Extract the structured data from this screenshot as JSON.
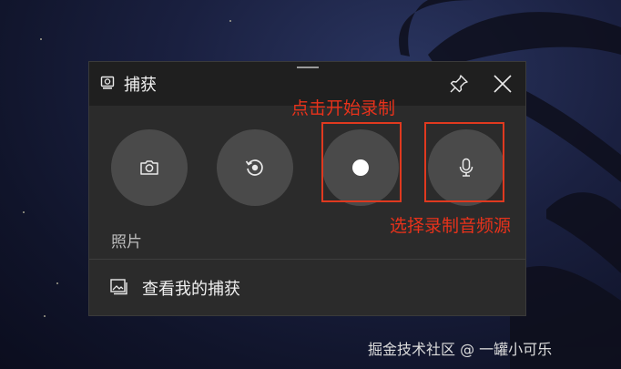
{
  "window": {
    "title": "捕获",
    "icon": "capture-icon"
  },
  "toolbar": {
    "pin_icon": "pin-icon",
    "close_icon": "close-icon"
  },
  "buttons": [
    {
      "name": "screenshot",
      "icon": "camera-icon"
    },
    {
      "name": "record-last-30s",
      "icon": "replay-icon"
    },
    {
      "name": "start-recording",
      "icon": "record-dot-icon"
    },
    {
      "name": "microphone",
      "icon": "microphone-icon"
    }
  ],
  "labels": {
    "photo": "照片"
  },
  "gallery": {
    "label": "查看我的捕获",
    "icon": "gallery-icon"
  },
  "annotations": {
    "record": "点击开始录制",
    "mic": "选择录制音频源",
    "color": "#e8321b"
  },
  "watermark": "掘金技术社区 @ 一罐小可乐"
}
